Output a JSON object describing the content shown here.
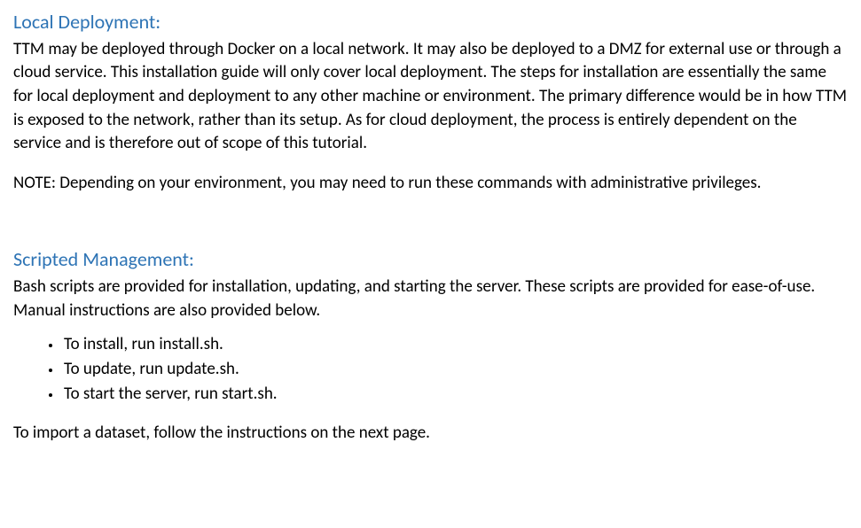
{
  "section1": {
    "heading": "Local Deployment:",
    "para1": "TTM may be deployed through Docker on a local network. It may also be deployed to a DMZ for external use or through a cloud service. This installation guide will only cover local deployment. The steps for installation are essentially the same for local deployment and deployment to any other machine or environment. The primary difference would be in how TTM is exposed to the network, rather than its setup. As for cloud deployment, the process is entirely dependent on the service and is therefore out of scope of this tutorial.",
    "para2": "NOTE: Depending on your environment, you may need to run these commands with administrative privileges."
  },
  "section2": {
    "heading": "Scripted Management:",
    "intro": "Bash scripts are provided for installation, updating, and starting the server. These scripts are provided for ease-of-use. Manual instructions are also provided below.",
    "bullets": [
      "To install, run install.sh.",
      "To update, run update.sh.",
      "To start the server, run start.sh."
    ],
    "outro": "To import a dataset, follow the instructions on the next page."
  }
}
